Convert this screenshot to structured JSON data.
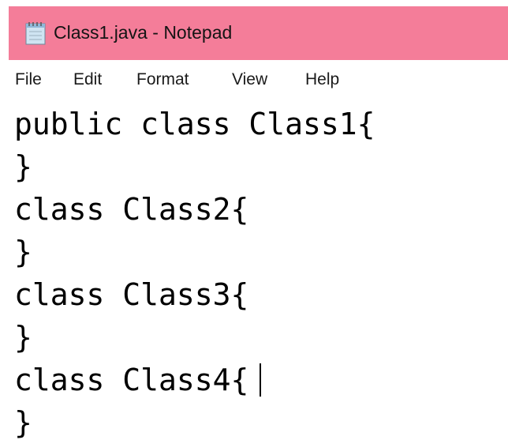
{
  "window": {
    "title": "Class1.java - Notepad",
    "title_bar_color": "#f47d99",
    "icon": "notepad-icon"
  },
  "menu": {
    "items": [
      {
        "label": "File"
      },
      {
        "label": "Edit"
      },
      {
        "label": "Format"
      },
      {
        "label": "View"
      },
      {
        "label": "Help"
      }
    ]
  },
  "editor": {
    "lines": [
      "public class Class1{",
      "}",
      "class Class2{",
      "}",
      "class Class3{",
      "}",
      "class Class4{",
      "}"
    ]
  }
}
